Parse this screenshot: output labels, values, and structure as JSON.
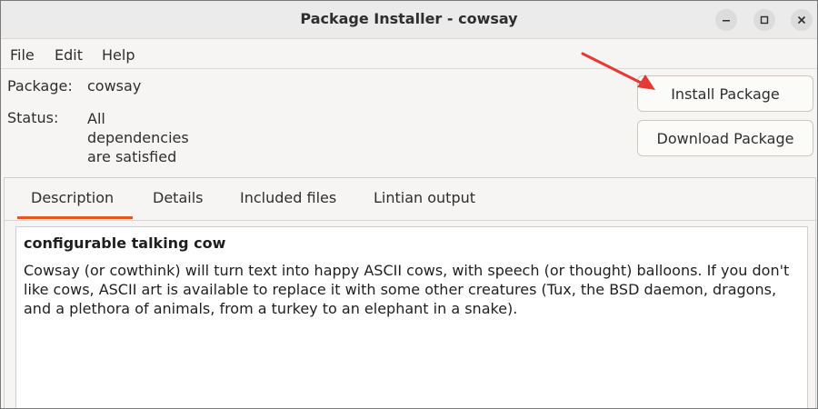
{
  "window": {
    "title": "Package Installer - cowsay"
  },
  "titlebar_buttons": [
    "minimize-icon",
    "maximize-icon",
    "close-icon"
  ],
  "menu": {
    "items": [
      "File",
      "Edit",
      "Help"
    ]
  },
  "package": {
    "label": "Package:",
    "value": "cowsay",
    "status_label": "Status:",
    "status_value": "All dependencies are satisfied"
  },
  "buttons": {
    "install": "Install Package",
    "download": "Download Package"
  },
  "tabs": [
    {
      "label": "Description",
      "active": true
    },
    {
      "label": "Details",
      "active": false
    },
    {
      "label": "Included files",
      "active": false
    },
    {
      "label": "Lintian output",
      "active": false
    }
  ],
  "description": {
    "summary": "configurable talking cow",
    "text": "Cowsay (or cowthink) will turn text into happy ASCII cows, with speech (or thought) balloons. If you don't like cows, ASCII art is available to replace it with some other creatures (Tux, the BSD daemon, dragons, and a plethora of animals, from a turkey to an elephant in a snake)."
  },
  "colors": {
    "accent": "#e95420",
    "annotation_arrow": "#e53935"
  }
}
